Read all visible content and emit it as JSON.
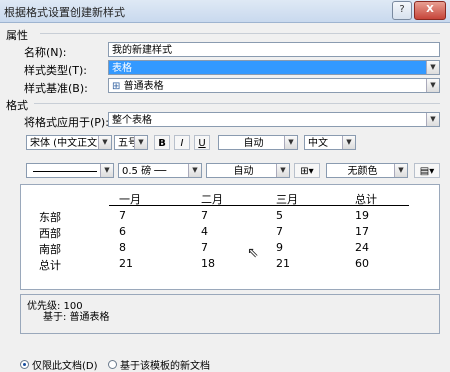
{
  "window": {
    "title": "根据格式设置创建新样式",
    "help": "?",
    "close": "X"
  },
  "properties": {
    "header": "属性",
    "name_label": "名称(N):",
    "name_value": "我的新建样式",
    "type_label": "样式类型(T):",
    "type_value": "表格",
    "based_label": "样式基准(B):",
    "based_value": "普通表格"
  },
  "format": {
    "header": "格式",
    "apply_label": "将格式应用于(P):",
    "apply_value": "整个表格",
    "font": "宋体 (中文正文)",
    "size": "五号",
    "bold": "B",
    "italic": "I",
    "underline": "U",
    "color": "自动",
    "lang": "中文",
    "border_width": "0.5 磅",
    "border_color": "自动",
    "shading": "无颜色"
  },
  "preview": {
    "headers": [
      "一月",
      "二月",
      "三月",
      "总计"
    ],
    "rows": [
      {
        "label": "东部",
        "values": [
          "7",
          "7",
          "5",
          "19"
        ]
      },
      {
        "label": "西部",
        "values": [
          "6",
          "4",
          "7",
          "17"
        ]
      },
      {
        "label": "南部",
        "values": [
          "8",
          "7",
          "9",
          "24"
        ]
      },
      {
        "label": "总计",
        "values": [
          "21",
          "18",
          "21",
          "60"
        ]
      }
    ]
  },
  "description": {
    "priority": "优先级: 100",
    "based_on": "基于: 普通表格"
  },
  "options": {
    "only_this_doc": "仅限此文档(D)",
    "new_docs_template": "基于该模板的新文档"
  },
  "colors": {
    "selection": "#3399ff",
    "accent": "#1a4fa0"
  }
}
